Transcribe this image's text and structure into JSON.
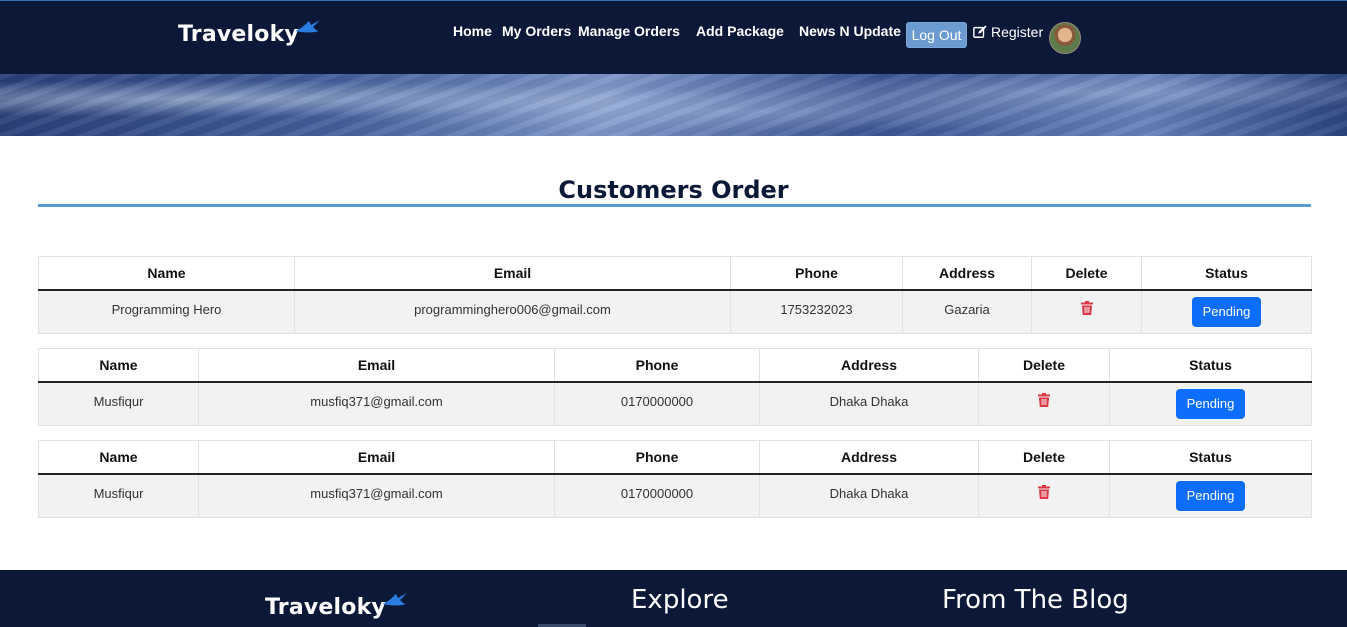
{
  "brand": {
    "name": "Traveloky"
  },
  "nav": {
    "links": [
      "Home",
      "My Orders",
      "Manage Orders",
      "Add Package",
      "News N Update"
    ],
    "logout_label": "Log Out",
    "register_label": "Register"
  },
  "page": {
    "title": "Customers Order"
  },
  "table_headers": [
    "Name",
    "Email",
    "Phone",
    "Address",
    "Delete",
    "Status"
  ],
  "orders": [
    {
      "name": "Programming Hero",
      "email": "programminghero006@gmail.com",
      "phone": "1753232023",
      "address": "Gazaria",
      "status": "Pending"
    },
    {
      "name": "Musfiqur",
      "email": "musfiq371@gmail.com",
      "phone": "0170000000",
      "address": "Dhaka Dhaka",
      "status": "Pending"
    },
    {
      "name": "Musfiqur",
      "email": "musfiq371@gmail.com",
      "phone": "0170000000",
      "address": "Dhaka Dhaka",
      "status": "Pending"
    }
  ],
  "footer": {
    "headings": [
      "Explore",
      "From The Blog"
    ]
  },
  "colors": {
    "navy": "#0b1838",
    "accent": "#5b9bd5",
    "primary": "#0d6efd",
    "danger": "#dc3545"
  }
}
